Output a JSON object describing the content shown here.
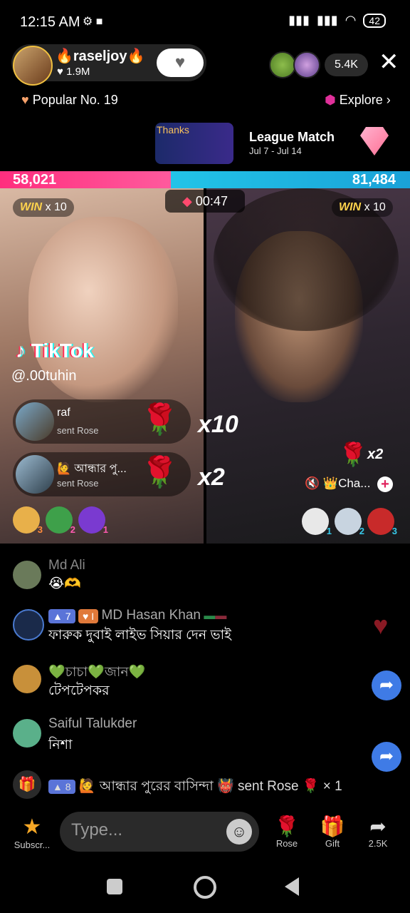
{
  "status_bar": {
    "time": "12:15 AM",
    "battery": "42"
  },
  "host": {
    "name": "🔥raseljoy🔥",
    "likes": "♥ 1.9M",
    "follow_icon": "heart-icon"
  },
  "viewers": {
    "count": "5.4K"
  },
  "popular": {
    "label": "Popular No. 19"
  },
  "explore": {
    "label": "Explore"
  },
  "league": {
    "thanks": "Thanks",
    "title": "League Match",
    "dates": "Jul 7 - Jul 14"
  },
  "battle": {
    "left_score": "58,021",
    "right_score": "81,484",
    "timer": "00:47",
    "left_win": "WIN",
    "left_win_mult": "x 10",
    "right_win": "WIN",
    "right_win_mult": "x 10",
    "score_left_fraction": 0.416
  },
  "left_stream": {
    "watermark": "TikTok",
    "username": "@.00tuhin",
    "gifts": [
      {
        "name": "raf",
        "sub": "sent Rose",
        "mult": "x10"
      },
      {
        "name": "🙋 আন্ধার পু...",
        "sub": "sent Rose",
        "mult": "x2"
      }
    ],
    "badge_counts": [
      "3",
      "2",
      "1"
    ]
  },
  "right_stream": {
    "rose_mult": "x2",
    "guest": "👑Cha...",
    "badge_counts": [
      "1",
      "2",
      "3"
    ]
  },
  "chat": [
    {
      "name": "Md Ali",
      "msg": "😭🫶"
    },
    {
      "level": "7",
      "fan": "I",
      "name": "MD Hasan Khan",
      "msg": "ফারুক দুবাই লাইভ সিয়ার দেন ভাই"
    },
    {
      "name": "💚চাচা💚জান💚",
      "msg": "টেপটেপকর"
    },
    {
      "name": "Saiful Talukder",
      "msg": "নিশা"
    }
  ],
  "system_gift": {
    "level": "8",
    "text": "🙋 আন্ধার পুরের বাসিন্দা 👹 sent Rose 🌹 × 1"
  },
  "bottom_bar": {
    "subscribe": "Subscr...",
    "type_placeholder": "Type...",
    "rose": "Rose",
    "gift": "Gift",
    "share": "2.5K"
  }
}
